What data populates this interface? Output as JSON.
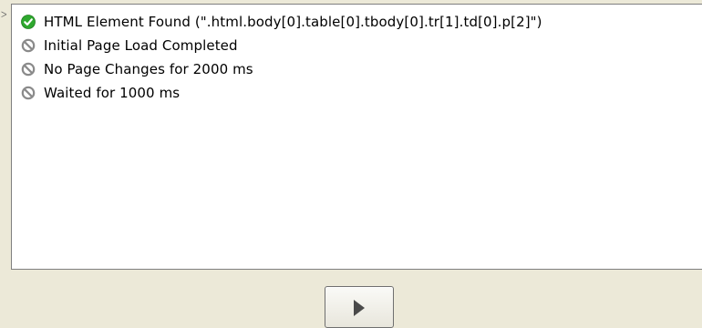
{
  "conditions": {
    "items": [
      {
        "label": "HTML Element Found (\".html.body[0].table[0].tbody[0].tr[1].td[0].p[2]\")",
        "icon": "check-circle-icon",
        "status": "satisfied"
      },
      {
        "label": "Initial Page Load Completed",
        "icon": "no-circle-icon",
        "status": "not-satisfied"
      },
      {
        "label": "No Page Changes for 2000 ms",
        "icon": "no-circle-icon",
        "status": "not-satisfied"
      },
      {
        "label": "Waited for 1000 ms",
        "icon": "no-circle-icon",
        "status": "not-satisfied"
      }
    ]
  },
  "controls": {
    "play_icon": "play-icon"
  },
  "colors": {
    "window_background": "#ece9d8",
    "panel_background": "#ffffff",
    "check_green": "#2ea82e",
    "disabled_gray": "#8a8a8a",
    "play_arrow": "#4a4a4a"
  }
}
